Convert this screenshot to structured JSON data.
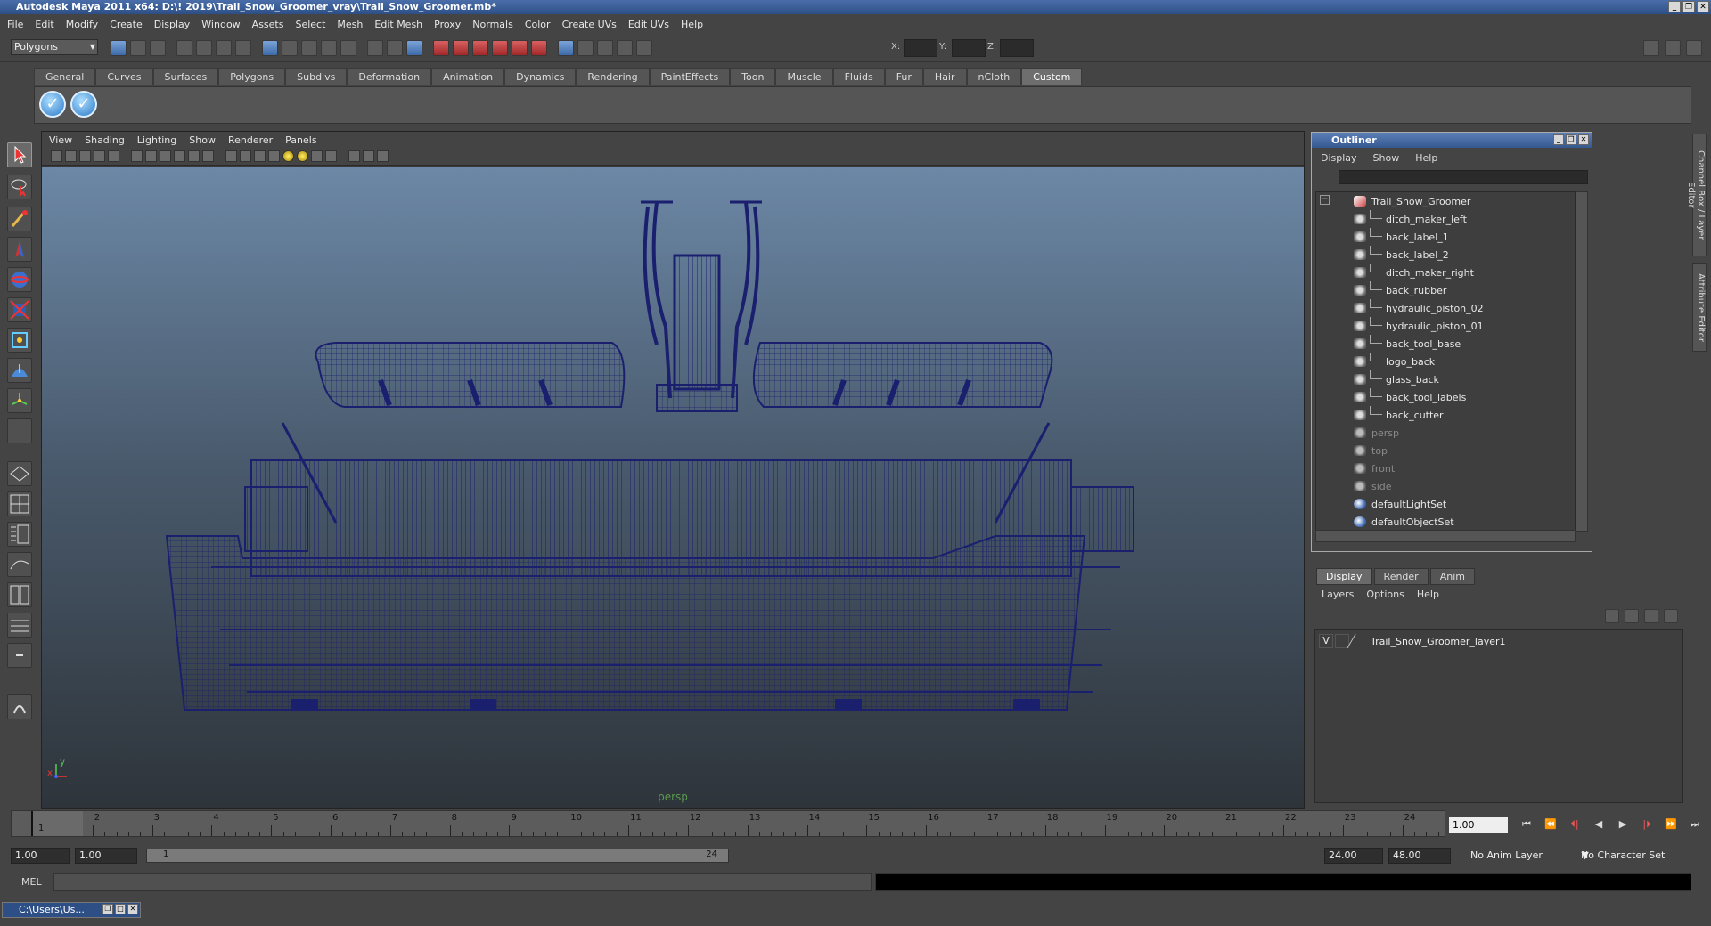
{
  "window": {
    "title": "Autodesk Maya 2011 x64: D:\\! 2019\\Trail_Snow_Groomer_vray\\Trail_Snow_Groomer.mb*",
    "minimize": "_",
    "restore": "❐",
    "close": "✕"
  },
  "menubar": [
    "File",
    "Edit",
    "Modify",
    "Create",
    "Display",
    "Window",
    "Assets",
    "Select",
    "Mesh",
    "Edit Mesh",
    "Proxy",
    "Normals",
    "Color",
    "Create UVs",
    "Edit UVs",
    "Help"
  ],
  "statusline": {
    "mode": "Polygons",
    "x_label": "X:",
    "y_label": "Y:",
    "z_label": "Z:"
  },
  "shelf_tabs": [
    "General",
    "Curves",
    "Surfaces",
    "Polygons",
    "Subdivs",
    "Deformation",
    "Animation",
    "Dynamics",
    "Rendering",
    "PaintEffects",
    "Toon",
    "Muscle",
    "Fluids",
    "Fur",
    "Hair",
    "nCloth",
    "Custom"
  ],
  "shelf_active": "Custom",
  "shelf_buttons": [
    "✓",
    "✓"
  ],
  "viewport": {
    "menu": [
      "View",
      "Shading",
      "Lighting",
      "Show",
      "Renderer",
      "Panels"
    ],
    "camera": "persp",
    "axis_x": "x",
    "axis_y": "y"
  },
  "outliner": {
    "title": "Outliner",
    "menu": [
      "Display",
      "Show",
      "Help"
    ],
    "expand": "−",
    "items": [
      {
        "label": "Trail_Snow_Groomer",
        "indent": 0,
        "icon": "group",
        "dim": false
      },
      {
        "label": "ditch_maker_left",
        "indent": 1,
        "icon": "mesh",
        "dim": false
      },
      {
        "label": "back_label_1",
        "indent": 1,
        "icon": "mesh",
        "dim": false
      },
      {
        "label": "back_label_2",
        "indent": 1,
        "icon": "mesh",
        "dim": false
      },
      {
        "label": "ditch_maker_right",
        "indent": 1,
        "icon": "mesh",
        "dim": false
      },
      {
        "label": "back_rubber",
        "indent": 1,
        "icon": "mesh",
        "dim": false
      },
      {
        "label": "hydraulic_piston_02",
        "indent": 1,
        "icon": "mesh",
        "dim": false
      },
      {
        "label": "hydraulic_piston_01",
        "indent": 1,
        "icon": "mesh",
        "dim": false
      },
      {
        "label": "back_tool_base",
        "indent": 1,
        "icon": "mesh",
        "dim": false
      },
      {
        "label": "logo_back",
        "indent": 1,
        "icon": "mesh",
        "dim": false
      },
      {
        "label": "glass_back",
        "indent": 1,
        "icon": "mesh",
        "dim": false
      },
      {
        "label": "back_tool_labels",
        "indent": 1,
        "icon": "mesh",
        "dim": false
      },
      {
        "label": "back_cutter",
        "indent": 1,
        "icon": "mesh",
        "dim": false
      },
      {
        "label": "persp",
        "indent": 0,
        "icon": "camera",
        "dim": true
      },
      {
        "label": "top",
        "indent": 0,
        "icon": "camera",
        "dim": true
      },
      {
        "label": "front",
        "indent": 0,
        "icon": "camera",
        "dim": true
      },
      {
        "label": "side",
        "indent": 0,
        "icon": "camera",
        "dim": true
      },
      {
        "label": "defaultLightSet",
        "indent": 0,
        "icon": "set",
        "dim": false
      },
      {
        "label": "defaultObjectSet",
        "indent": 0,
        "icon": "set",
        "dim": false
      }
    ]
  },
  "layers": {
    "tabs": [
      "Display",
      "Render",
      "Anim"
    ],
    "active_tab": "Display",
    "menu": [
      "Layers",
      "Options",
      "Help"
    ],
    "rows": [
      {
        "visible": "V",
        "name": "Trail_Snow_Groomer_layer1"
      }
    ]
  },
  "side_tabs": [
    "Channel Box / Layer Editor",
    "Attribute Editor"
  ],
  "timeline": {
    "ticks": [
      "1",
      "2",
      "3",
      "4",
      "5",
      "6",
      "7",
      "8",
      "9",
      "10",
      "11",
      "12",
      "13",
      "14",
      "15",
      "16",
      "17",
      "18",
      "19",
      "20",
      "21",
      "22",
      "23",
      "24"
    ],
    "current_frame": "1",
    "current_time_field": "1.00"
  },
  "range": {
    "start_time": "1.00",
    "playback_start": "1.00",
    "slider_start": "1",
    "slider_end": "24",
    "playback_end": "24.00",
    "end_time": "48.00",
    "anim_layer": "No Anim Layer",
    "char_set": "No Character Set"
  },
  "playback_buttons": [
    "⏮",
    "⏪",
    "⏴|",
    "◀",
    "▶",
    "|⏵",
    "⏩",
    "⏭"
  ],
  "mel": {
    "label": "MEL"
  },
  "taskbar": {
    "item": "C:\\Users\\Us..."
  },
  "colors": {
    "wireframe": "#1a1f6e",
    "accent": "#2d4f86"
  }
}
